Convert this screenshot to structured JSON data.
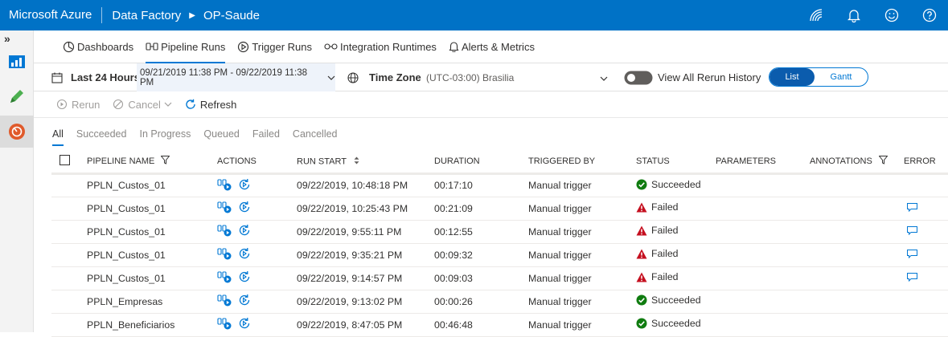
{
  "header": {
    "brand": "Microsoft Azure",
    "service": "Data Factory",
    "factory": "OP-Saude",
    "icons": [
      "feedback-signal-icon",
      "bell-icon",
      "smiley-icon",
      "help-icon"
    ]
  },
  "left_rail": {
    "expand": "»",
    "items": [
      "overview-icon",
      "author-pencil-icon",
      "monitor-icon"
    ]
  },
  "nav_tabs": [
    {
      "label": "Dashboards",
      "icon": "dashboard-icon"
    },
    {
      "label": "Pipeline Runs",
      "icon": "pipeline-icon",
      "active": true
    },
    {
      "label": "Trigger Runs",
      "icon": "trigger-icon"
    },
    {
      "label": "Integration Runtimes",
      "icon": "integration-runtime-icon"
    },
    {
      "label": "Alerts & Metrics",
      "icon": "bell-icon"
    }
  ],
  "filter": {
    "range_label": "Last 24 Hours",
    "range_value": "09/21/2019 11:38 PM - 09/22/2019 11:38 PM",
    "timezone_label": "Time Zone",
    "timezone_value": "(UTC-03:00) Brasilia",
    "rerun_toggle_label": "View All Rerun History",
    "rerun_toggle_on": false,
    "view_list": "List",
    "view_gantt": "Gantt",
    "active_view": "List"
  },
  "toolbar": {
    "rerun": "Rerun",
    "cancel": "Cancel",
    "refresh": "Refresh"
  },
  "status_tabs": [
    "All",
    "Succeeded",
    "In Progress",
    "Queued",
    "Failed",
    "Cancelled"
  ],
  "table": {
    "columns": {
      "pipeline_name": "PIPELINE NAME",
      "actions": "ACTIONS",
      "run_start": "RUN START",
      "duration": "DURATION",
      "triggered_by": "TRIGGERED BY",
      "status": "STATUS",
      "parameters": "PARAMETERS",
      "annotations": "ANNOTATIONS",
      "error": "ERROR"
    },
    "rows": [
      {
        "name": "PPLN_Custos_01",
        "run_start": "09/22/2019, 10:48:18 PM",
        "duration": "00:17:10",
        "triggered_by": "Manual trigger",
        "status": "Succeeded",
        "has_error": false
      },
      {
        "name": "PPLN_Custos_01",
        "run_start": "09/22/2019, 10:25:43 PM",
        "duration": "00:21:09",
        "triggered_by": "Manual trigger",
        "status": "Failed",
        "has_error": true
      },
      {
        "name": "PPLN_Custos_01",
        "run_start": "09/22/2019, 9:55:11 PM",
        "duration": "00:12:55",
        "triggered_by": "Manual trigger",
        "status": "Failed",
        "has_error": true
      },
      {
        "name": "PPLN_Custos_01",
        "run_start": "09/22/2019, 9:35:21 PM",
        "duration": "00:09:32",
        "triggered_by": "Manual trigger",
        "status": "Failed",
        "has_error": true
      },
      {
        "name": "PPLN_Custos_01",
        "run_start": "09/22/2019, 9:14:57 PM",
        "duration": "00:09:03",
        "triggered_by": "Manual trigger",
        "status": "Failed",
        "has_error": true
      },
      {
        "name": "PPLN_Empresas",
        "run_start": "09/22/2019, 9:13:02 PM",
        "duration": "00:00:26",
        "triggered_by": "Manual trigger",
        "status": "Succeeded",
        "has_error": false
      },
      {
        "name": "PPLN_Beneficiarios",
        "run_start": "09/22/2019, 8:47:05 PM",
        "duration": "00:46:48",
        "triggered_by": "Manual trigger",
        "status": "Succeeded",
        "has_error": false
      }
    ]
  },
  "colors": {
    "header_bg": "#0072c6",
    "accent": "#0078d4",
    "success": "#107c10",
    "failed": "#c50f1f"
  }
}
